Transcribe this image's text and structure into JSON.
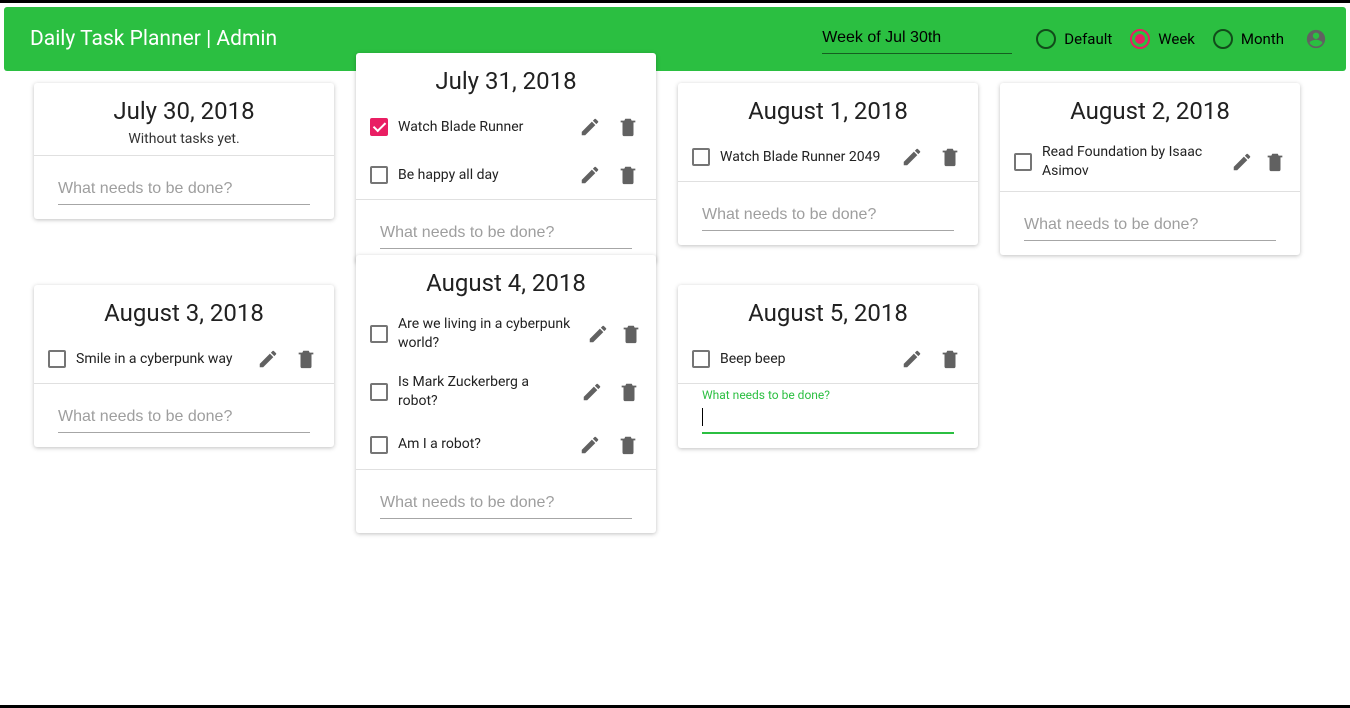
{
  "header": {
    "app_title": "Daily Task Planner | Admin",
    "week_value": "Week of Jul 30th",
    "view_options": [
      {
        "id": "default",
        "label": "Default",
        "selected": false
      },
      {
        "id": "week",
        "label": "Week",
        "selected": true
      },
      {
        "id": "month",
        "label": "Month",
        "selected": false
      }
    ]
  },
  "add_placeholder": "What needs to be done?",
  "days": [
    {
      "date": "July 30, 2018",
      "empty_note": "Without tasks yet.",
      "tasks": [],
      "focused": false,
      "big": false
    },
    {
      "date": "July 31, 2018",
      "tasks": [
        {
          "label": "Watch Blade Runner",
          "done": true
        },
        {
          "label": "Be happy all day",
          "done": false
        }
      ],
      "focused": false,
      "big": true
    },
    {
      "date": "August 1, 2018",
      "tasks": [
        {
          "label": "Watch Blade Runner 2049",
          "done": false
        }
      ],
      "focused": false,
      "big": false
    },
    {
      "date": "August 2, 2018",
      "tasks": [
        {
          "label": "Read Foundation by Isaac Asimov",
          "done": false
        }
      ],
      "focused": false,
      "big": false
    },
    {
      "date": "August 3, 2018",
      "tasks": [
        {
          "label": "Smile in a cyberpunk way",
          "done": false
        }
      ],
      "focused": false,
      "big": false
    },
    {
      "date": "August 4, 2018",
      "tasks": [
        {
          "label": "Are we living in a cyberpunk world?",
          "done": false
        },
        {
          "label": "Is Mark Zuckerberg a robot?",
          "done": false
        },
        {
          "label": "Am I a robot?",
          "done": false
        }
      ],
      "focused": false,
      "big": true
    },
    {
      "date": "August 5, 2018",
      "tasks": [
        {
          "label": "Beep beep",
          "done": false
        }
      ],
      "focused": true,
      "big": false
    }
  ]
}
